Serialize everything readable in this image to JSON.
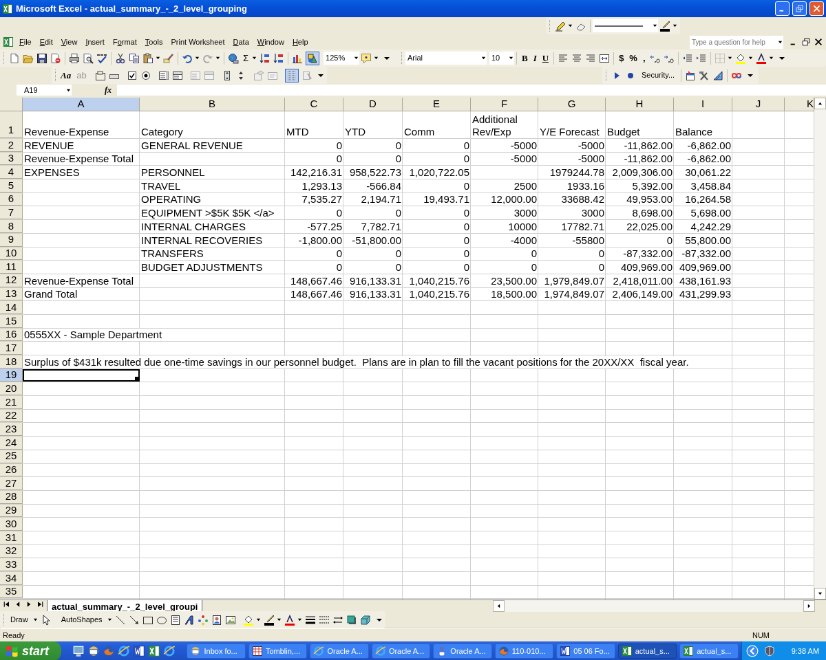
{
  "window": {
    "title": "Microsoft Excel - actual_summary_-_2_level_grouping"
  },
  "menu": [
    {
      "key": "F",
      "post": "ile"
    },
    {
      "key": "E",
      "post": "dit"
    },
    {
      "key": "V",
      "post": "iew"
    },
    {
      "key": "I",
      "post": "nsert"
    },
    {
      "pre": "F",
      "key": "o",
      "post": "rmat"
    },
    {
      "key": "T",
      "post": "ools"
    },
    {
      "pre": "Print Worksheet"
    },
    {
      "key": "D",
      "post": "ata"
    },
    {
      "key": "W",
      "post": "indow"
    },
    {
      "key": "H",
      "post": "elp"
    }
  ],
  "help_box": {
    "placeholder": "Type a question for help"
  },
  "standard_toolbar": {
    "sum": "Σ",
    "zoom": "125%",
    "drawing_selected": true
  },
  "formatting_toolbar": {
    "font": "Arial",
    "size": "10",
    "glyphs": [
      "B",
      "I",
      "U",
      "$",
      "%",
      ","
    ]
  },
  "forms_toolbar": {
    "label_glyph": "Aa",
    "edit_glyph": "ab",
    "grid_selected": true
  },
  "security_toolbar": {
    "label": "Security..."
  },
  "name_box": "A19",
  "function_label": "fx",
  "sheet": {
    "columns": [
      {
        "label": "A",
        "selected": true
      },
      {
        "label": "B",
        "selected": false
      },
      {
        "label": "C",
        "selected": false,
        "numeric": true
      },
      {
        "label": "D",
        "selected": false,
        "numeric": true
      },
      {
        "label": "E",
        "selected": false,
        "numeric": true
      },
      {
        "label": "F",
        "selected": false,
        "numeric": true
      },
      {
        "label": "G",
        "selected": false,
        "numeric": true
      },
      {
        "label": "H",
        "selected": false,
        "numeric": true
      },
      {
        "label": "I",
        "selected": false,
        "numeric": true
      },
      {
        "label": "J",
        "selected": false
      },
      {
        "label": "K",
        "selected": false
      }
    ],
    "rows": [
      {
        "number": "1",
        "kind": "header",
        "selected": false,
        "cells": [
          "Revenue-Expense",
          "Category",
          "MTD",
          "YTD",
          "Comm",
          "Additional\nRev/Exp",
          "Y/E Forecast",
          "Budget",
          "Balance"
        ]
      },
      {
        "number": "2",
        "kind": "data",
        "selected": false,
        "cells": [
          "REVENUE",
          "GENERAL REVENUE",
          "0",
          "0",
          "0",
          "-5000",
          "-5000",
          "-11,862.00",
          "-6,862.00"
        ]
      },
      {
        "number": "3",
        "kind": "data",
        "selected": false,
        "cells": [
          "Revenue-Expense Total",
          null,
          "0",
          "0",
          "0",
          "-5000",
          "-5000",
          "-11,862.00",
          "-6,862.00"
        ]
      },
      {
        "number": "4",
        "kind": "data",
        "selected": false,
        "cells": [
          "EXPENSES",
          "PERSONNEL",
          "142,216.31",
          "958,522.73",
          "1,020,722.05",
          null,
          "1979244.78",
          "2,009,306.00",
          "30,061.22"
        ]
      },
      {
        "number": "5",
        "kind": "data",
        "selected": false,
        "cells": [
          null,
          "TRAVEL",
          "1,293.13",
          "-566.84",
          "0",
          "2500",
          "1933.16",
          "5,392.00",
          "3,458.84"
        ]
      },
      {
        "number": "6",
        "kind": "data",
        "selected": false,
        "cells": [
          null,
          "OPERATING",
          "7,535.27",
          "2,194.71",
          "19,493.71",
          "12,000.00",
          "33688.42",
          "49,953.00",
          "16,264.58"
        ]
      },
      {
        "number": "7",
        "kind": "data",
        "selected": false,
        "cells": [
          null,
          "EQUIPMENT >$5K $5K </a>",
          "0",
          "0",
          "0",
          "3000",
          "3000",
          "8,698.00",
          "5,698.00"
        ]
      },
      {
        "number": "8",
        "kind": "data",
        "selected": false,
        "cells": [
          null,
          "INTERNAL CHARGES",
          "-577.25",
          "7,782.71",
          "0",
          "10000",
          "17782.71",
          "22,025.00",
          "4,242.29"
        ]
      },
      {
        "number": "9",
        "kind": "data",
        "selected": false,
        "cells": [
          null,
          "INTERNAL RECOVERIES",
          "-1,800.00",
          "-51,800.00",
          "0",
          "-4000",
          "-55800",
          "0",
          "55,800.00"
        ]
      },
      {
        "number": "10",
        "kind": "data",
        "selected": false,
        "cells": [
          null,
          "TRANSFERS",
          "0",
          "0",
          "0",
          "0",
          "0",
          "-87,332.00",
          "-87,332.00"
        ]
      },
      {
        "number": "11",
        "kind": "data",
        "selected": false,
        "cells": [
          null,
          "BUDGET ADJUSTMENTS",
          "0",
          "0",
          "0",
          "0",
          "0",
          "409,969.00",
          "409,969.00"
        ]
      },
      {
        "number": "12",
        "kind": "data",
        "selected": false,
        "cells": [
          "Revenue-Expense Total",
          null,
          "148,667.46",
          "916,133.31",
          "1,040,215.76",
          "23,500.00",
          "1,979,849.07",
          "2,418,011.00",
          "438,161.93"
        ]
      },
      {
        "number": "13",
        "kind": "data",
        "selected": false,
        "cells": [
          "Grand Total",
          null,
          "148,667.46",
          "916,133.31",
          "1,040,215.76",
          "18,500.00",
          "1,974,849.07",
          "2,406,149.00",
          "431,299.93"
        ]
      },
      {
        "number": "14",
        "kind": "data",
        "selected": false
      },
      {
        "number": "15",
        "kind": "data",
        "selected": false
      },
      {
        "number": "16",
        "kind": "note",
        "selected": false,
        "cells": [
          "0555XX - Sample Department"
        ]
      },
      {
        "number": "17",
        "kind": "data",
        "selected": false
      },
      {
        "number": "18",
        "kind": "note",
        "selected": false,
        "cells": [
          "Surplus of $431k resulted due one-time savings in our personnel budget.  Plans are in plan to fill the vacant positions for the 20XX/XX  fiscal year."
        ]
      },
      {
        "number": "19",
        "kind": "data",
        "selected": true
      },
      {
        "number": "20",
        "kind": "data",
        "selected": false
      },
      {
        "number": "21",
        "kind": "data",
        "selected": false
      },
      {
        "number": "22",
        "kind": "data",
        "selected": false
      },
      {
        "number": "23",
        "kind": "data",
        "selected": false
      },
      {
        "number": "24",
        "kind": "data",
        "selected": false
      },
      {
        "number": "25",
        "kind": "data",
        "selected": false
      },
      {
        "number": "26",
        "kind": "data",
        "selected": false
      },
      {
        "number": "27",
        "kind": "data",
        "selected": false
      },
      {
        "number": "28",
        "kind": "data",
        "selected": false
      },
      {
        "number": "29",
        "kind": "data",
        "selected": false
      },
      {
        "number": "30",
        "kind": "data",
        "selected": false
      },
      {
        "number": "31",
        "kind": "data",
        "selected": false
      },
      {
        "number": "32",
        "kind": "data",
        "selected": false
      },
      {
        "number": "33",
        "kind": "data",
        "selected": false
      },
      {
        "number": "34",
        "kind": "data",
        "selected": false
      },
      {
        "number": "35",
        "kind": "data",
        "selected": false
      }
    ]
  },
  "sheet_tabs": [
    {
      "label": "actual_summary_-_2_level_groupi",
      "selected": true
    }
  ],
  "draw_toolbar": {
    "draw": "Draw",
    "autoshapes": "AutoShapes"
  },
  "status_bar": {
    "left": "Ready",
    "right": "NUM"
  },
  "taskbar": {
    "start": "start",
    "clock": "9:38 AM",
    "tasks": [
      {
        "label": "Inbox fo...",
        "selected": false
      },
      {
        "label": "Tomblin,...",
        "selected": false
      },
      {
        "label": "Oracle A...",
        "selected": false
      },
      {
        "label": "Oracle A...",
        "selected": false
      },
      {
        "label": "Oracle A...",
        "selected": false
      },
      {
        "label": "110-010...",
        "selected": false
      },
      {
        "label": "05 06 Fo...",
        "selected": false
      },
      {
        "label": "actual_s...",
        "selected": true
      },
      {
        "label": "actual_s...",
        "selected": false
      }
    ]
  }
}
